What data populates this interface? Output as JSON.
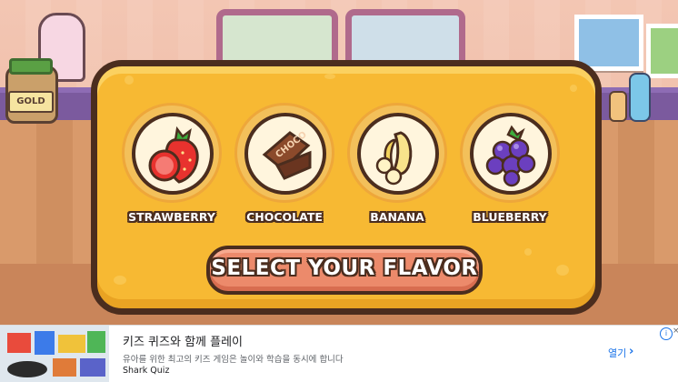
{
  "background": {
    "jar_label": "GOLD"
  },
  "flavors": [
    {
      "label": "STRAWBERRY",
      "icon": "strawberry-icon"
    },
    {
      "label": "CHOCOLATE",
      "icon": "chocolate-icon"
    },
    {
      "label": "BANANA",
      "icon": "banana-icon"
    },
    {
      "label": "BLUEBERRY",
      "icon": "blueberry-icon"
    }
  ],
  "chocolate_bar_text": "CHOCO",
  "select_button": {
    "label": "SELECT YOUR FLAVOR"
  },
  "ad": {
    "title": "키즈 퀴즈와 함께 플레이",
    "description": "유아를 위한 최고의 키즈 게임은 놀이와 학습을 동시에 합니다",
    "brand": "Shark Quiz",
    "cta": "열기",
    "cta_icon": "chevron-right-icon",
    "info_icon": "info-icon",
    "close_icon": "close-icon"
  },
  "colors": {
    "panel": "#f7b933",
    "outline": "#4b2d1e",
    "button": "#ec8a6b",
    "counter": "#7b5a9e"
  }
}
